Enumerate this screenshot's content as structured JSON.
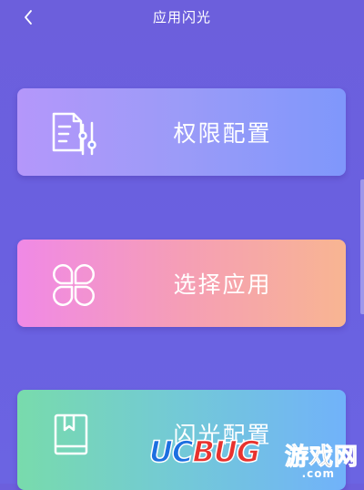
{
  "header": {
    "title": "应用闪光",
    "back_icon": "chevron-left-icon"
  },
  "cards": [
    {
      "label": "权限配置",
      "icon": "document-settings-icon"
    },
    {
      "label": "选择应用",
      "icon": "four-leaf-app-icon"
    },
    {
      "label": "闪光配置",
      "icon": "book-icon"
    }
  ],
  "watermark": {
    "brand_part1": "UC",
    "brand_part2": "BUG",
    "brand_cn": "游戏网",
    "domain": ".com"
  },
  "colors": {
    "background": "#6a60e0",
    "card1": "#9b9bf8",
    "card2": "#f59eb6",
    "card3": "#73c9d7",
    "text": "#ffffff"
  }
}
